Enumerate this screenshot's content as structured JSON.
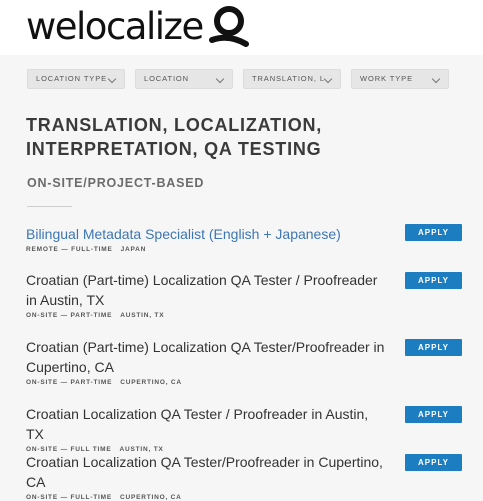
{
  "header": {
    "logo_text": "welocalize"
  },
  "filters": [
    {
      "label": "LOCATION TYPE"
    },
    {
      "label": "LOCATION"
    },
    {
      "label": "TRANSLATION, L..."
    },
    {
      "label": "WORK TYPE"
    }
  ],
  "category": {
    "title": "TRANSLATION, LOCALIZATION, INTERPRETATION, QA TESTING",
    "subcategory": "ON-SITE/PROJECT-BASED"
  },
  "jobs": [
    {
      "title": "Bilingual Metadata Specialist (English + Japanese)",
      "meta": "REMOTE — FULL-TIME",
      "location": "JAPAN",
      "apply_label": "APPLY"
    },
    {
      "title": "Croatian (Part-time) Localization QA Tester / Proofreader in Austin, TX",
      "meta": "ON-SITE — PART-TIME",
      "location": "AUSTIN, TX",
      "apply_label": "APPLY"
    },
    {
      "title": "Croatian (Part-time) Localization QA Tester/Proofreader in Cupertino, CA",
      "meta": "ON-SITE — PART-TIME",
      "location": "CUPERTINO, CA",
      "apply_label": "APPLY"
    },
    {
      "title": "Croatian Localization QA Tester / Proofreader in Austin, TX",
      "meta": "ON-SITE — FULL TIME",
      "location": "AUSTIN, TX",
      "apply_label": "APPLY"
    },
    {
      "title": "Croatian Localization QA Tester/Proofreader in Cupertino, CA",
      "meta": "ON-SITE — FULL-TIME",
      "location": "CUPERTINO, CA",
      "apply_label": "APPLY"
    }
  ],
  "colors": {
    "accent": "#1d7dc1",
    "link": "#3d76b5"
  }
}
